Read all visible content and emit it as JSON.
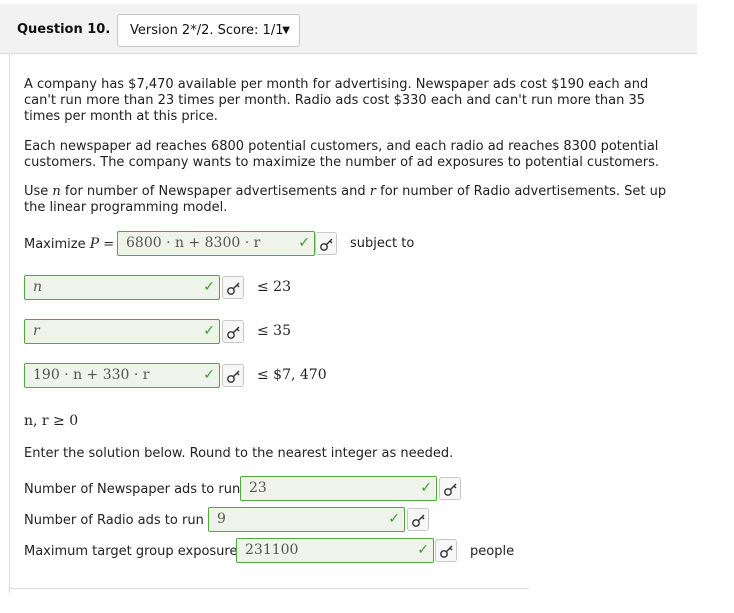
{
  "header": {
    "question_label": "Question 10.",
    "version_select": "Version 2*/2. Score: 1/1"
  },
  "problem": {
    "para1": "A company has $7,470 available per month for advertising. Newspaper ads cost $190 each and can't run more than 23 times per month. Radio ads cost $330 each and can't run more than 35 times per month at this price.",
    "para2": "Each newspaper ad reaches 6800 potential customers, and each radio ad reaches 8300 potential customers. The company wants to maximize the number of ad exposures to potential customers.",
    "para3": {
      "t1": "Use ",
      "var_n": "n",
      "t2": " for number of Newspaper advertisements and ",
      "var_r": "r",
      "t3": " for number of Radio advertisements. Set up the linear programming model."
    }
  },
  "objective": {
    "label_prefix": "Maximize",
    "var": "P",
    "equals": "=",
    "value": "6800 · n + 8300 · r",
    "suffix": "subject to"
  },
  "constraints": [
    {
      "value": "n",
      "rhs": "≤ 23"
    },
    {
      "value": "r",
      "rhs": "≤ 35"
    },
    {
      "value": "190 · n + 330 · r",
      "rhs": "≤ $7, 470"
    }
  ],
  "nonneg": "n, r ≥ 0",
  "solution_prompt": "Enter the solution below. Round to the nearest integer as needed.",
  "answers": [
    {
      "label": "Number of Newspaper ads to run is",
      "value": "23"
    },
    {
      "label": "Number of Radio ads to run is",
      "value": "9"
    },
    {
      "label": "Maximum target group exposure is",
      "value": "231100",
      "suffix": "people"
    }
  ],
  "icons": {
    "correct": "checkmark-icon",
    "key": "key-icon"
  },
  "colors": {
    "correct_border": "#4fa93a",
    "correct_fill": "#eef4e9",
    "check": "#3b9b2a"
  }
}
